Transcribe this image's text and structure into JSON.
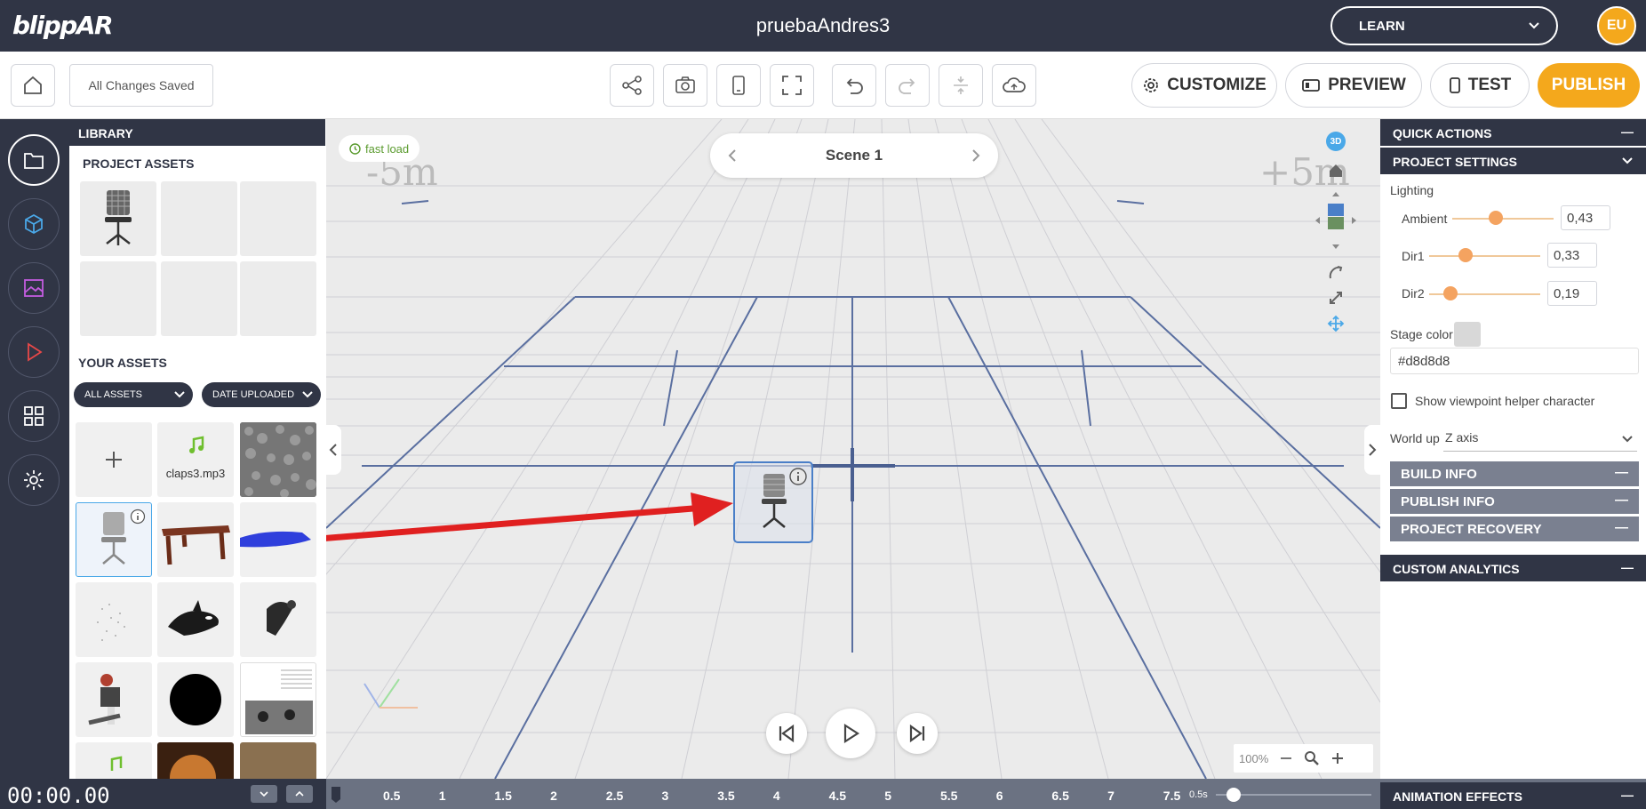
{
  "header": {
    "logo": "blippAR",
    "project_title": "pruebaAndres3",
    "learn_label": "LEARN",
    "avatar_initials": "EU"
  },
  "toolbar": {
    "saved_status": "All Changes Saved",
    "customize_label": "CUSTOMIZE",
    "preview_label": "PREVIEW",
    "test_label": "TEST",
    "publish_label": "PUBLISH"
  },
  "library": {
    "title": "LIBRARY",
    "project_assets_label": "PROJECT ASSETS",
    "your_assets_label": "YOUR ASSETS",
    "filter_all": "ALL ASSETS",
    "filter_sort": "DATE UPLOADED",
    "audio_asset_name": "claps3.mp3"
  },
  "viewport": {
    "fast_load": "fast load",
    "scene_name": "Scene 1",
    "left_marker": "-5m",
    "right_marker": "+5m",
    "zoom_level": "100%",
    "view_mode": "3D"
  },
  "quick_actions": {
    "title": "QUICK ACTIONS"
  },
  "project_settings": {
    "title": "PROJECT SETTINGS",
    "lighting_label": "Lighting",
    "ambient_label": "Ambient",
    "ambient_value": "0,43",
    "ambient_level": 0.43,
    "dir1_label": "Dir1",
    "dir1_value": "0,33",
    "dir1_level": 0.33,
    "dir2_label": "Dir2",
    "dir2_value": "0,19",
    "dir2_level": 0.19,
    "stage_color_label": "Stage color",
    "stage_color_value": "#d8d8d8",
    "viewpoint_label": "Show viewpoint helper character",
    "world_up_label": "World up",
    "world_up_value": "Z axis",
    "build_info": "BUILD INFO",
    "publish_info": "PUBLISH INFO",
    "project_recovery": "PROJECT RECOVERY"
  },
  "custom_analytics": {
    "title": "CUSTOM ANALYTICS"
  },
  "animation_effects": {
    "title": "ANIMATION EFFECTS"
  },
  "timeline": {
    "time": "00:00.00",
    "ticks": [
      "0.5",
      "1",
      "1.5",
      "2",
      "2.5",
      "3",
      "3.5",
      "4",
      "4.5",
      "5",
      "5.5",
      "6",
      "6.5",
      "7",
      "7.5"
    ],
    "scale": "0.5s"
  },
  "colors": {
    "dark": "#303545",
    "accent": "#f4a81c",
    "grid": "#5a6fa0"
  }
}
